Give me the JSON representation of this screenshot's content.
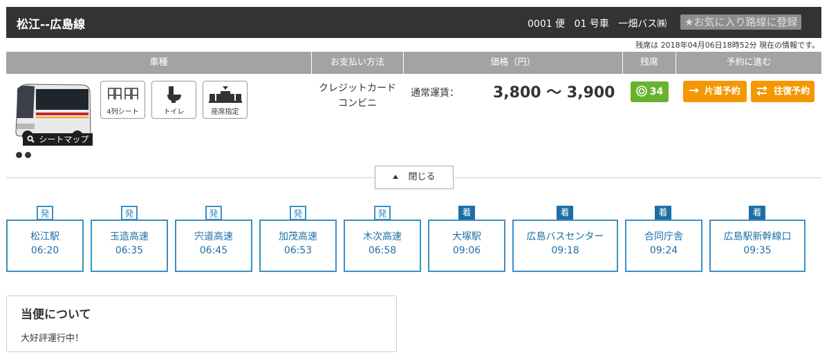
{
  "header": {
    "route_title": "松江--広島線",
    "bus_no": "0001 便",
    "car_no": "01 号車",
    "operator": "一畑バス㈱",
    "favorite_label": "★お気に入り路線に登録"
  },
  "timestamp": "残席は 2018年04月06日18時52分 現在の情報です。",
  "columns": [
    "車種",
    "お支払い方法",
    "価格（円）",
    "残席",
    "予約に進む"
  ],
  "vehicle": {
    "seatmap_label": "シートマップ",
    "features": [
      "4列シート",
      "トイレ",
      "座席指定"
    ]
  },
  "payment": [
    "クレジットカード",
    "コンビニ"
  ],
  "fare": {
    "label": "通常運賃：",
    "value": "3,800 ～ 3,900"
  },
  "seats_remaining": "34",
  "reserve": {
    "oneway": "片道予約",
    "roundtrip": "往復予約"
  },
  "close_label": "閉じる",
  "stops": [
    {
      "tag": "発",
      "name": "松江駅",
      "time": "06:20"
    },
    {
      "tag": "発",
      "name": "玉造高速",
      "time": "06:35"
    },
    {
      "tag": "発",
      "name": "宍道高速",
      "time": "06:45"
    },
    {
      "tag": "発",
      "name": "加茂高速",
      "time": "06:53"
    },
    {
      "tag": "発",
      "name": "木次高速",
      "time": "06:58"
    },
    {
      "tag": "着",
      "name": "大塚駅",
      "time": "09:06"
    },
    {
      "tag": "着",
      "name": "広島バスセンター",
      "time": "09:18"
    },
    {
      "tag": "着",
      "name": "合同庁舎",
      "time": "09:24"
    },
    {
      "tag": "着",
      "name": "広島駅新幹線口",
      "time": "09:35"
    }
  ],
  "about": {
    "title": "当便について",
    "body": "大好評運行中！"
  },
  "colors": {
    "header_bg": "#333333",
    "accent_orange": "#f39800",
    "seat_green": "#67b32e",
    "stop_blue": "#3a8ec6",
    "arrive_blue": "#1b6fa5"
  }
}
